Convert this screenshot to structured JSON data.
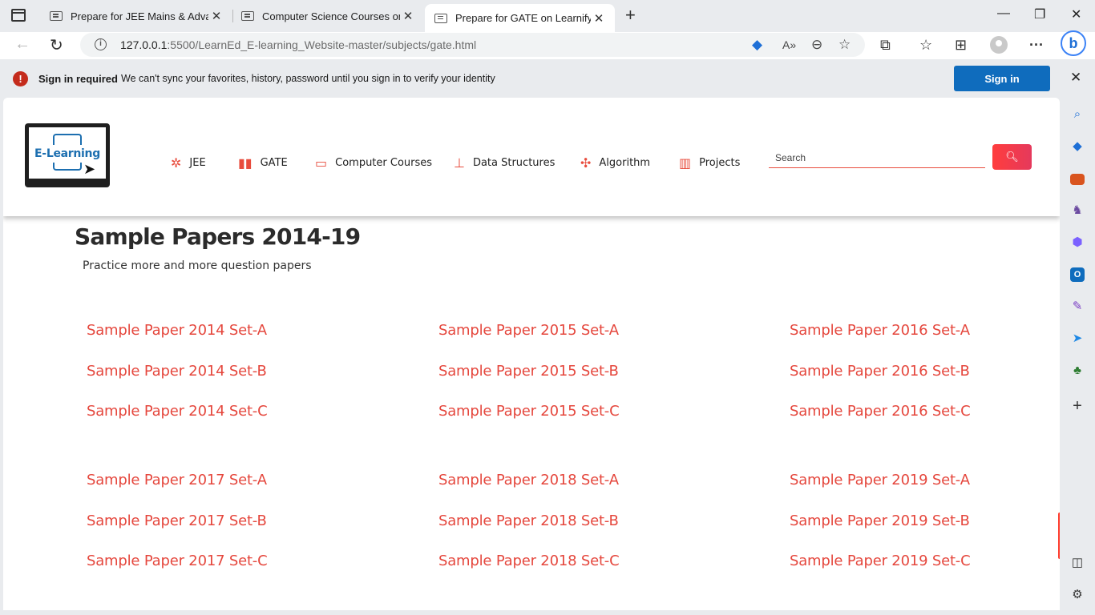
{
  "browser": {
    "tabs": [
      {
        "label": "Prepare for JEE Mains & Advance"
      },
      {
        "label": "Computer Science Courses on Le"
      },
      {
        "label": "Prepare for GATE on Learnify"
      }
    ],
    "tab_close": "✕",
    "new_tab": "+",
    "window_controls": {
      "minimize": "—",
      "maximize": "❐",
      "close": "✕"
    },
    "url_host": "127.0.0.1",
    "url_rest": ":5500/LearnEd_E-learning_Website-master/subjects/gate.html",
    "infobar": {
      "title": "Sign in required",
      "message": "We can't sync your favorites, history, password until you sign in to verify your identity",
      "button": "Sign in"
    }
  },
  "site": {
    "logo_text": "E-Learning",
    "nav": [
      {
        "label": "JEE",
        "icon": "atom-icon"
      },
      {
        "label": "GATE",
        "icon": "book-icon"
      },
      {
        "label": "Computer Courses",
        "icon": "laptop-icon"
      },
      {
        "label": "Data Structures",
        "icon": "sitemap-icon"
      },
      {
        "label": "Algorithm",
        "icon": "cogs-icon"
      },
      {
        "label": "Projects",
        "icon": "grid-icon"
      }
    ],
    "search": {
      "placeholder": "Search"
    }
  },
  "content": {
    "title": "Sample Papers 2014-19",
    "subtitle": "Practice more and more question papers",
    "papers": [
      "Sample Paper 2014 Set-A",
      "Sample Paper 2015 Set-A",
      "Sample Paper 2016 Set-A",
      "Sample Paper 2014 Set-B",
      "Sample Paper 2015 Set-B",
      "Sample Paper 2016 Set-B",
      "Sample Paper 2014 Set-C",
      "Sample Paper 2015 Set-C",
      "Sample Paper 2016 Set-C",
      "Sample Paper 2017 Set-A",
      "Sample Paper 2018 Set-A",
      "Sample Paper 2019 Set-A",
      "Sample Paper 2017 Set-B",
      "Sample Paper 2018 Set-B",
      "Sample Paper 2019 Set-B",
      "Sample Paper 2017 Set-C",
      "Sample Paper 2018 Set-C",
      "Sample Paper 2019 Set-C"
    ]
  },
  "colors": {
    "accent": "#e5473d",
    "signin": "#0f6cbd"
  }
}
